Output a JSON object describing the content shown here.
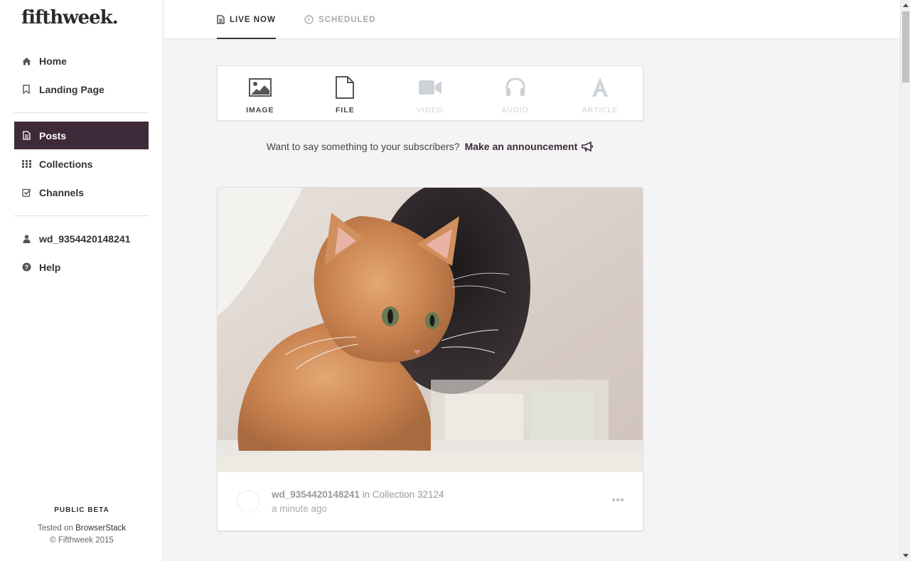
{
  "app": {
    "logo": "fifthweek."
  },
  "sidebar": {
    "items": [
      {
        "label": "Home",
        "icon": "home-icon"
      },
      {
        "label": "Landing Page",
        "icon": "bookmark-icon"
      },
      {
        "label": "Posts",
        "icon": "document-icon",
        "active": true
      },
      {
        "label": "Collections",
        "icon": "grid-icon"
      },
      {
        "label": "Channels",
        "icon": "checkbox-icon"
      },
      {
        "label": "wd_9354420148241",
        "icon": "user-icon"
      },
      {
        "label": "Help",
        "icon": "help-icon"
      }
    ],
    "footer": {
      "beta": "PUBLIC BETA",
      "tested_prefix": "Tested on",
      "tested_link": "BrowserStack",
      "copyright": "© Fifthweek 2015"
    }
  },
  "tabs": [
    {
      "label": "LIVE NOW",
      "icon": "document-icon",
      "active": true
    },
    {
      "label": "SCHEDULED",
      "icon": "clock-icon",
      "active": false
    }
  ],
  "post_types": [
    {
      "label": "IMAGE",
      "icon": "image-icon",
      "enabled": true
    },
    {
      "label": "FILE",
      "icon": "file-icon",
      "enabled": true
    },
    {
      "label": "VIDEO",
      "icon": "video-camera-icon",
      "enabled": false
    },
    {
      "label": "AUDIO",
      "icon": "headphones-icon",
      "enabled": false
    },
    {
      "label": "ARTICLE",
      "icon": "font-icon",
      "enabled": false
    }
  ],
  "announcement": {
    "prompt": "Want to say something to your subscribers?",
    "link": "Make an announcement"
  },
  "post": {
    "author": "wd_9354420148241",
    "in_word": "in",
    "collection": "Collection 32124",
    "time": "a minute ago"
  },
  "colors": {
    "accent": "#3f2a3a",
    "disabled": "#cdd2d8"
  }
}
